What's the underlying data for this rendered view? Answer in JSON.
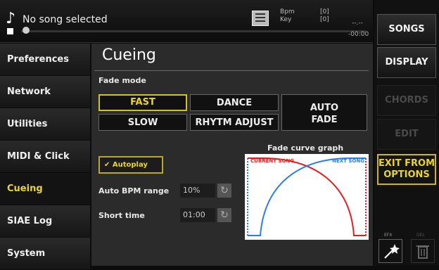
{
  "topbar": {
    "song_title": "No song selected",
    "bpm_label": "Bpm",
    "key_label": "Key",
    "bpm_value": "[0]",
    "key_value": "[0]",
    "time_dash": "--.--",
    "time_value": "-00:00"
  },
  "sidebar": {
    "items": [
      {
        "label": "Preferences"
      },
      {
        "label": "Network"
      },
      {
        "label": "Utilities"
      },
      {
        "label": "MIDI & Click"
      },
      {
        "label": "Cueing"
      },
      {
        "label": "SIAE Log"
      },
      {
        "label": "System"
      }
    ],
    "active": "Cueing"
  },
  "main": {
    "title": "Cueing",
    "fade_mode_label": "Fade mode",
    "fade_buttons": {
      "fast": "FAST",
      "dance": "DANCE",
      "slow": "SLOW",
      "rhytm_adjust": "RHYTM ADJUST",
      "auto_fade_line1": "AUTO",
      "auto_fade_line2": "FADE"
    },
    "selected_fade": "FAST",
    "autoplay_label": "Autoplay",
    "autoplay_checked": true,
    "auto_bpm_range_label": "Auto BPM range",
    "auto_bpm_range_value": "10%",
    "short_time_label": "Short time",
    "short_time_value": "01:00",
    "graph": {
      "title": "Fade curve graph",
      "current_song_label": "CURRENT SONG",
      "next_song_label": "NEXT SONG",
      "current_color": "#e02020",
      "next_color": "#2a7de1"
    }
  },
  "right_panel": {
    "songs": "SONGS",
    "display": "DISPLAY",
    "chords": "CHORDS",
    "edit": "EDIT",
    "exit_line1": "EXIT FROM",
    "exit_line2": "OPTIONS",
    "efx_label": "EFX",
    "del_label": "DEL",
    "efx_icon": "magic-wand-icon",
    "del_icon": "trash-icon"
  },
  "colors": {
    "accent": "#e8d534",
    "background": "#2b2b2b"
  }
}
